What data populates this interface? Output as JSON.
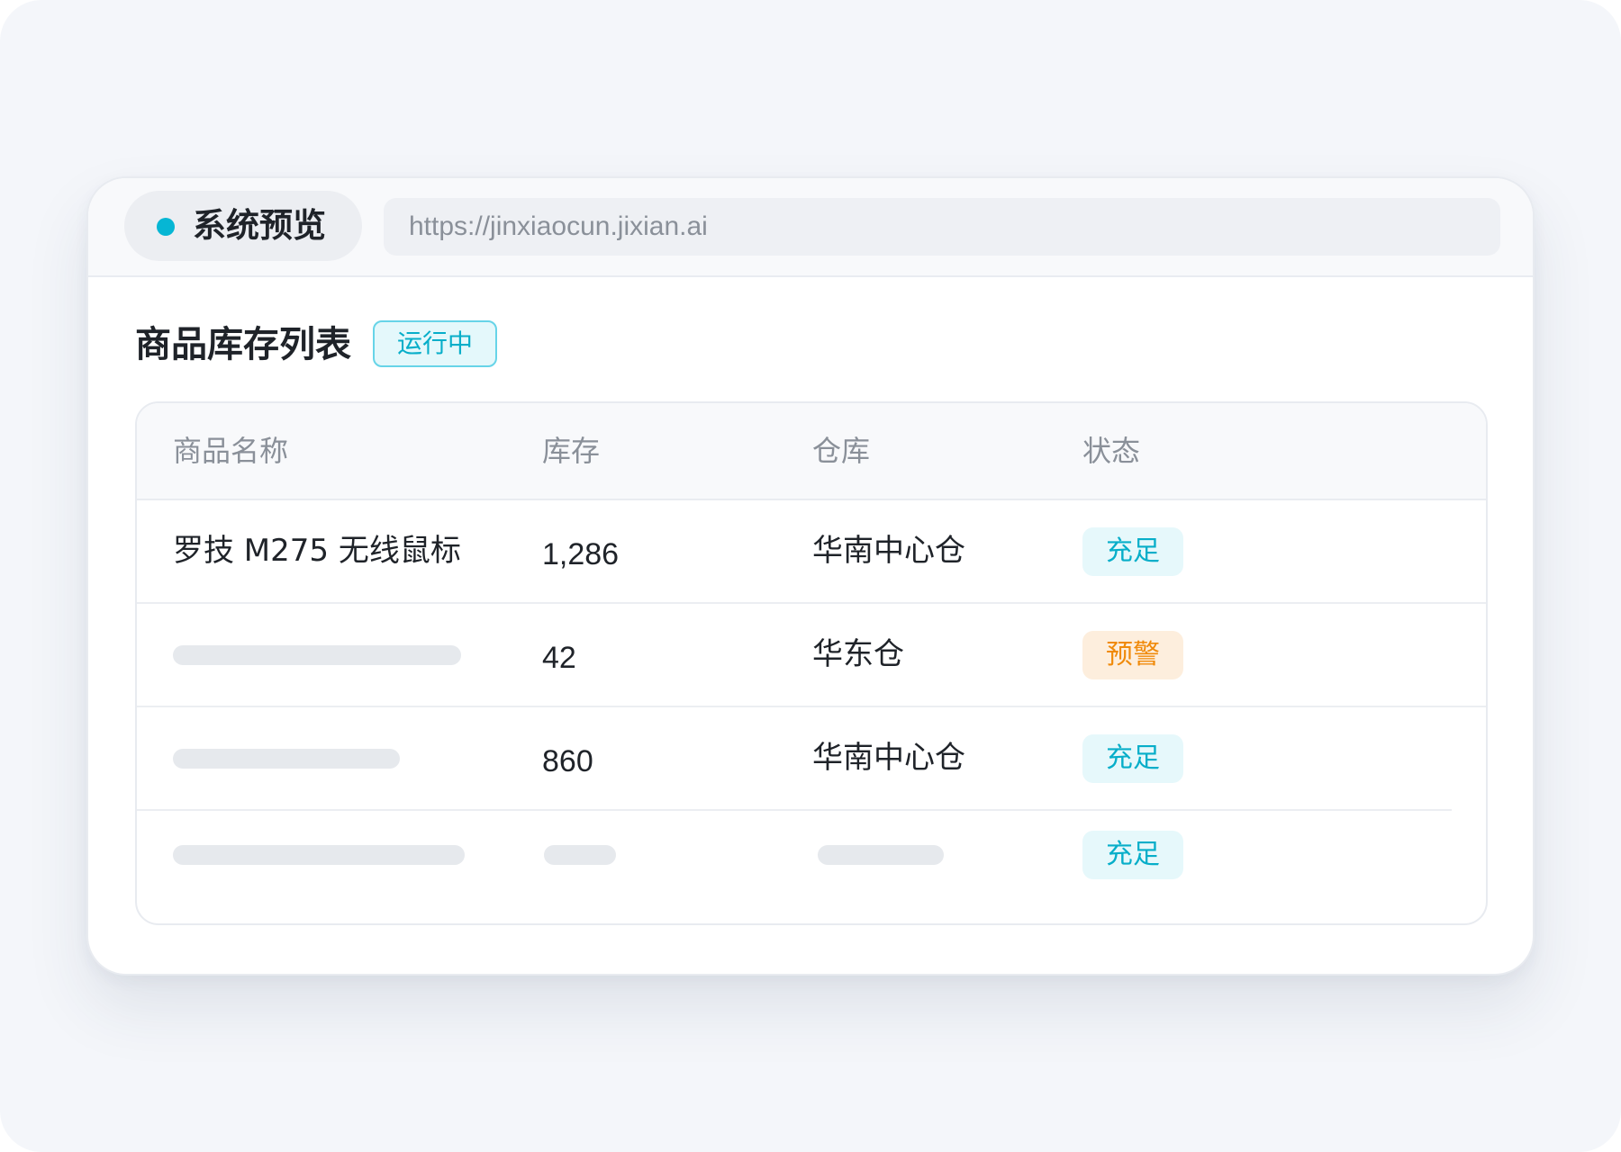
{
  "browser": {
    "preview_label": "系统预览",
    "url": "https://jinxiaocun.jixian.ai",
    "colors": {
      "accent": "#06b6d4"
    }
  },
  "page": {
    "title": "商品库存列表",
    "status_tag": "运行中"
  },
  "table": {
    "columns": [
      "商品名称",
      "库存",
      "仓库",
      "状态"
    ],
    "rows": [
      {
        "name": "罗技 M275 无线鼠标",
        "stock": "1,286",
        "warehouse": "华南中心仓",
        "status": "充足",
        "status_type": "ok"
      },
      {
        "name": "",
        "stock": "42",
        "warehouse": "华东仓",
        "status": "预警",
        "status_type": "warn"
      },
      {
        "name": "",
        "stock": "860",
        "warehouse": "华南中心仓",
        "status": "充足",
        "status_type": "ok"
      },
      {
        "name": "",
        "stock": "",
        "warehouse": "",
        "status": "充足",
        "status_type": "ok"
      }
    ],
    "status_colors": {
      "ok": "#07aec9",
      "warn": "#f08a0a"
    }
  }
}
